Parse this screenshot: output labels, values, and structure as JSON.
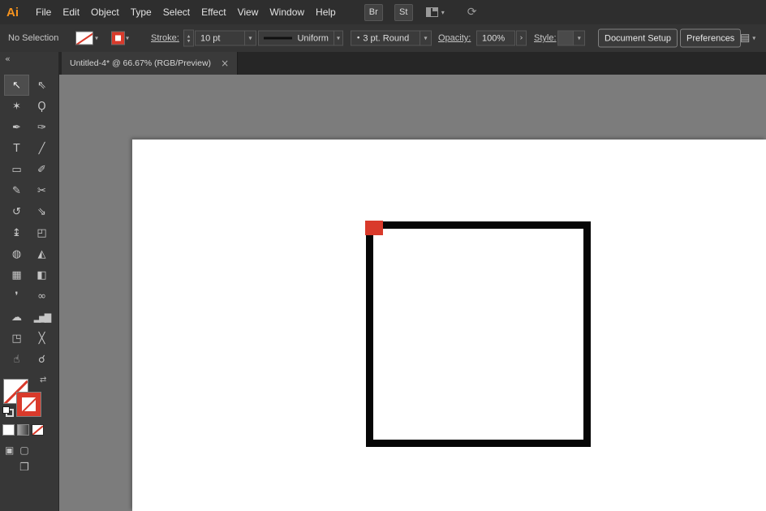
{
  "colors": {
    "brand-orange": "#f7941e",
    "swatch-red": "#d93a2b",
    "canvas-bg": "#7c7c7c",
    "artboard-white": "#ffffff"
  },
  "icons": {
    "chevron": "▾",
    "stepper_up": "▴",
    "stepper_down": "▾",
    "flyout": "›",
    "swap": "⇄",
    "collapse": "«",
    "close": "×",
    "brush_dot": "•",
    "screen_mode": "❐",
    "draw_normal": "▣",
    "draw_behind": "▢",
    "panel": "▤",
    "sync": "⟳"
  },
  "menubar": {
    "logo": "Ai",
    "items": [
      "File",
      "Edit",
      "Object",
      "Type",
      "Select",
      "Effect",
      "View",
      "Window",
      "Help"
    ],
    "bridge": "Br",
    "stock": "St"
  },
  "controlbar": {
    "selection_status": "No Selection",
    "stroke_label": "Stroke:",
    "stroke_weight": "10 pt",
    "width_profile": "Uniform",
    "brush_name": "3 pt. Round",
    "opacity_label": "Opacity:",
    "opacity_value": "100%",
    "style_label": "Style:",
    "document_setup": "Document Setup",
    "preferences": "Preferences"
  },
  "tab": {
    "title": "Untitled-4* @ 66.67% (RGB/Preview)"
  },
  "toolbar": {
    "tools": [
      {
        "name": "selection-tool",
        "glyph": "↖",
        "selected": true
      },
      {
        "name": "direct-selection-tool",
        "glyph": "⇖"
      },
      {
        "name": "magic-wand-tool",
        "glyph": "✶"
      },
      {
        "name": "lasso-tool",
        "glyph": "Ϙ"
      },
      {
        "name": "pen-tool",
        "glyph": "✒"
      },
      {
        "name": "curvature-tool",
        "glyph": "✑"
      },
      {
        "name": "type-tool",
        "glyph": "T"
      },
      {
        "name": "line-segment-tool",
        "glyph": "╱"
      },
      {
        "name": "rectangle-tool",
        "glyph": "▭"
      },
      {
        "name": "paintbrush-tool",
        "glyph": "✐"
      },
      {
        "name": "shaper-tool",
        "glyph": "✎"
      },
      {
        "name": "scissors-tool",
        "glyph": "✂"
      },
      {
        "name": "rotate-tool",
        "glyph": "↺"
      },
      {
        "name": "scale-tool",
        "glyph": "⇘"
      },
      {
        "name": "width-tool",
        "glyph": "↨"
      },
      {
        "name": "free-transform-tool",
        "glyph": "◰"
      },
      {
        "name": "shape-builder-tool",
        "glyph": "◍"
      },
      {
        "name": "perspective-grid-tool",
        "glyph": "◭"
      },
      {
        "name": "mesh-tool",
        "glyph": "▦"
      },
      {
        "name": "gradient-tool",
        "glyph": "◧"
      },
      {
        "name": "eyedropper-tool",
        "glyph": "❜"
      },
      {
        "name": "blend-tool",
        "glyph": "∞"
      },
      {
        "name": "symbol-sprayer-tool",
        "glyph": "☁"
      },
      {
        "name": "column-graph-tool",
        "glyph": "▂▅▇"
      },
      {
        "name": "artboard-tool",
        "glyph": "◳"
      },
      {
        "name": "slice-tool",
        "glyph": "╳"
      },
      {
        "name": "hand-tool",
        "glyph": "☝"
      },
      {
        "name": "zoom-tool",
        "glyph": "☌"
      }
    ]
  },
  "artwork": {
    "rectangle": {
      "stroke_color": "#060606",
      "corner_marker_color": "#d93a2b",
      "fill": "white"
    }
  }
}
